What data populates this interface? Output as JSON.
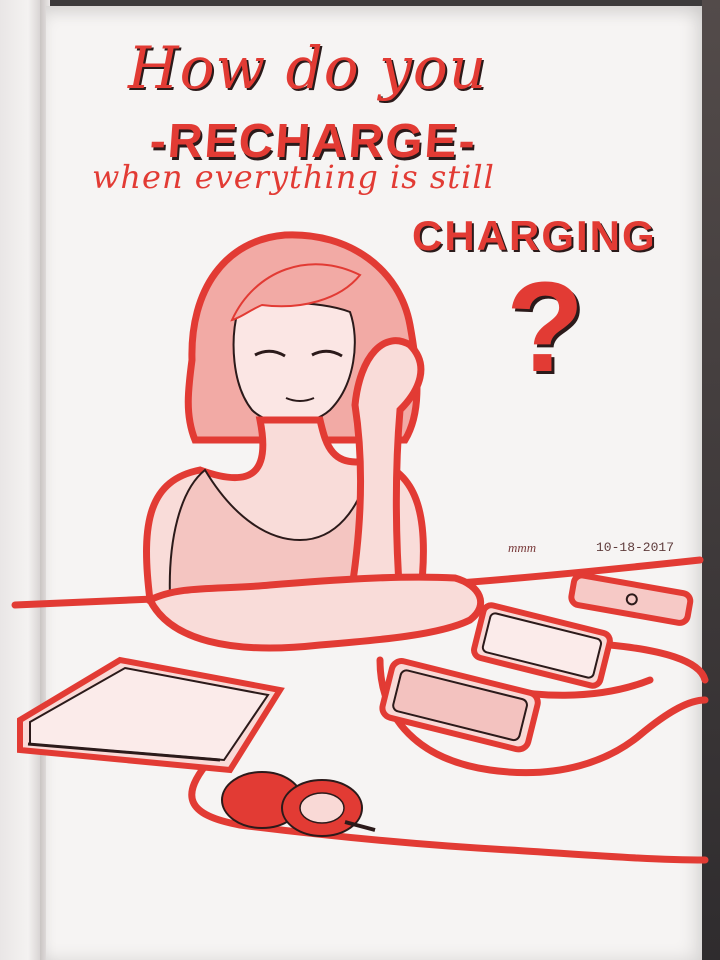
{
  "artwork": {
    "title_line1": "How do you",
    "title_line2": "-RECHARGE-",
    "title_line3": "when everything is still",
    "title_line4": "CHARGING",
    "question_mark": "?",
    "signature": "mmm",
    "date": "10-18-2017"
  },
  "colors": {
    "ink_red": "#e23b34",
    "ink_dark": "#2b1a1a",
    "paper": "#f6f4f3"
  },
  "subjects": [
    "woman-leaning-on-arm",
    "laptop",
    "headphones",
    "smartphone",
    "tablet",
    "power-bank",
    "charging-cables"
  ]
}
